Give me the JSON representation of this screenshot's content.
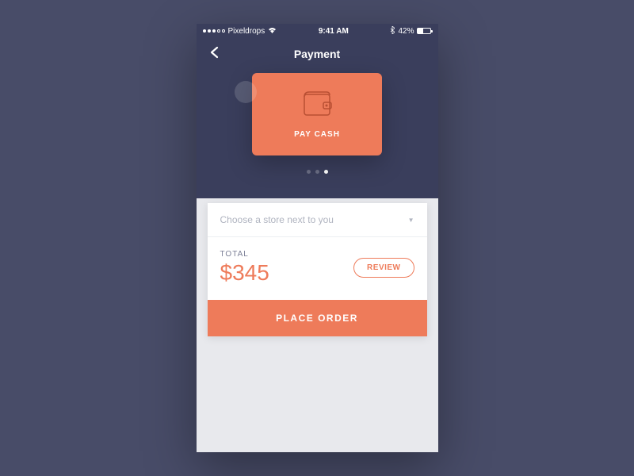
{
  "statusBar": {
    "carrier": "Pixeldrops",
    "time": "9:41 AM",
    "battery": "42%"
  },
  "nav": {
    "title": "Payment"
  },
  "paymentCard": {
    "label": "PAY CASH"
  },
  "storeSelect": {
    "placeholder": "Choose a store next to you"
  },
  "total": {
    "label": "TOTAL",
    "amount": "$345"
  },
  "buttons": {
    "review": "REVIEW",
    "placeOrder": "PLACE ORDER"
  }
}
